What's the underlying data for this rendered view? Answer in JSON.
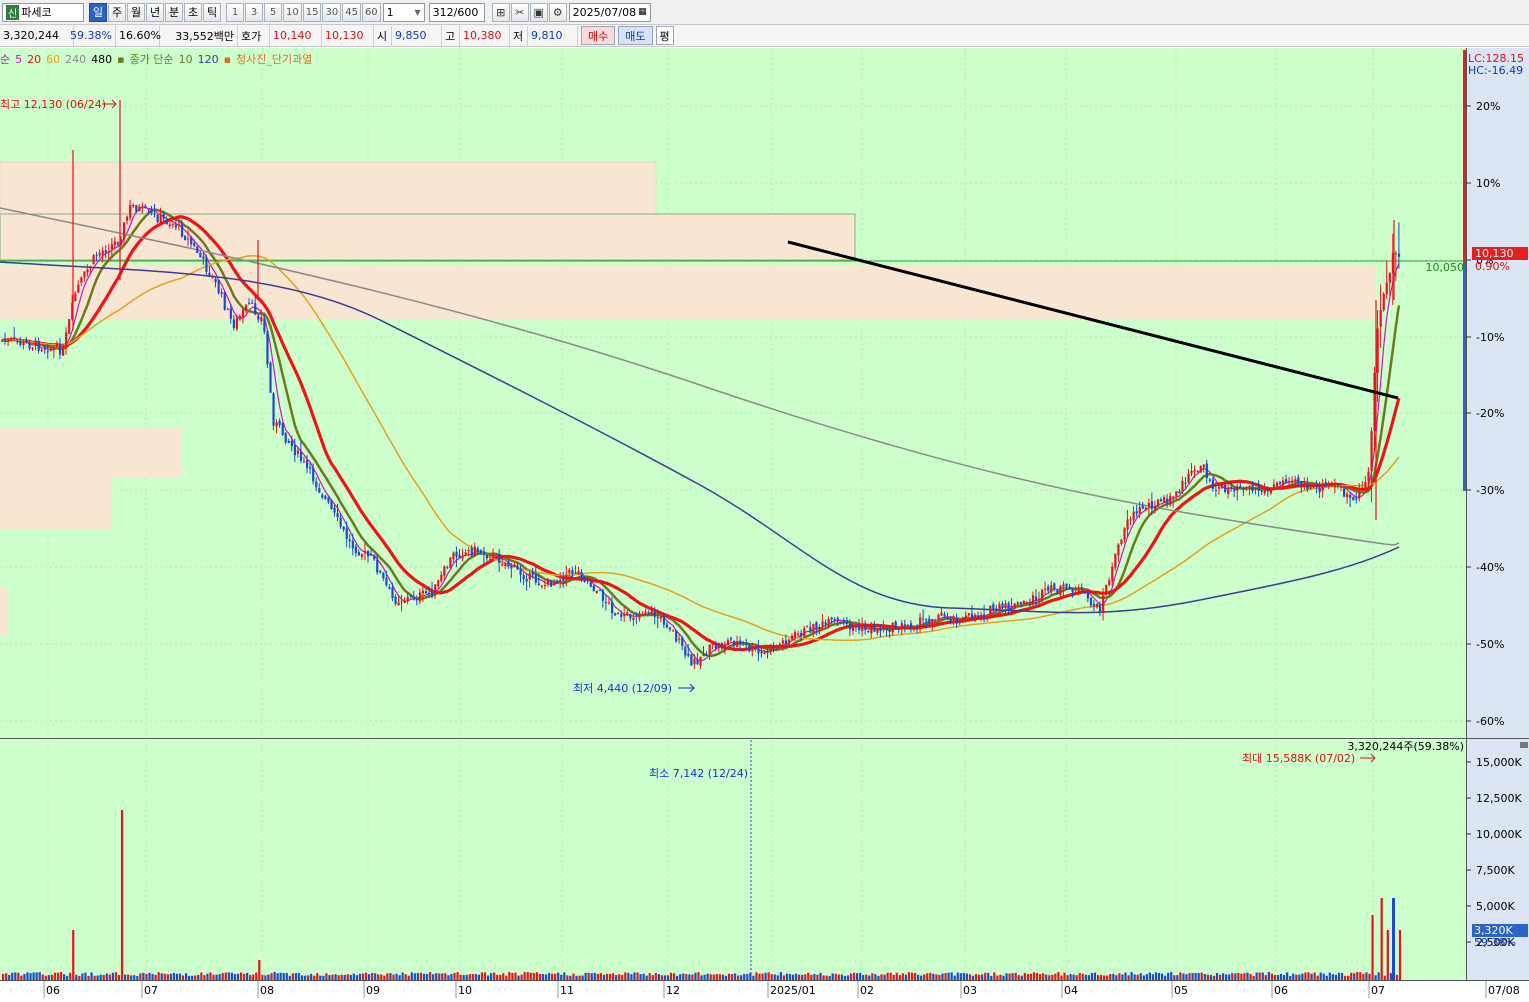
{
  "toolbar": {
    "badge": "신",
    "stock_name": "파세코",
    "periods": [
      "일",
      "주",
      "월",
      "년",
      "분",
      "초",
      "틱"
    ],
    "active_period": "일",
    "intervals": [
      "1",
      "3",
      "5",
      "10",
      "15",
      "30",
      "45",
      "60"
    ],
    "count_value": "1",
    "range_value": "312",
    "range_total": "/600",
    "date_value": "2025/07/08"
  },
  "quote": {
    "volume": "3,320,244",
    "volume_ratio": "59.38%",
    "turnover_rate": "16.60%",
    "amount": "33,552백만",
    "ask_label": "호가",
    "ask": "10,140",
    "bid": "10,130",
    "open_label": "시",
    "open": "9,850",
    "high_label": "고",
    "high": "10,380",
    "low_label": "저",
    "low": "9,810",
    "buy_label": "매수",
    "sell_label": "매도",
    "avg_label": "평"
  },
  "legend": {
    "ma_prefix": "순",
    "ma_items": [
      {
        "label": "5",
        "color": "#d012c8"
      },
      {
        "label": "20",
        "color": "#ef1414"
      },
      {
        "label": "60",
        "color": "#e3a21a"
      },
      {
        "label": "240",
        "color": "#8a8a8a"
      },
      {
        "label": "480",
        "color": "#000000"
      }
    ],
    "vol_prefix": "종가 단순",
    "vol_items": [
      {
        "label": "10",
        "color": "#6b7a1a"
      },
      {
        "label": "120",
        "color": "#3d3d8f"
      }
    ],
    "signal": "청사진_단기과열",
    "signal_color": "#e07020"
  },
  "price_panel": {
    "right_header_lc": "LC:128.15",
    "right_header_hc": "HC:-16.49",
    "pct_ticks": [
      "20%",
      "10%",
      "0%",
      "-10%",
      "-20%",
      "-30%",
      "-40%",
      "-50%",
      "-60%"
    ],
    "current_price": "10,130",
    "current_change": "0.90%",
    "ref_line_label": "10,050",
    "high_annotation": "최고 12,130 (06/24)",
    "low_annotation": "최저 4,440 (12/09)"
  },
  "volume_panel": {
    "top_label": "3,320,244주(59.38%)",
    "max_annotation": "최대 15,588K (07/02)",
    "min_annotation": "최소 7,142 (12/24)",
    "ticks": [
      "15,000K",
      "12,500K",
      "10,000K",
      "7,500K",
      "5,000K",
      "2,500K"
    ],
    "current_volume": "3,320K",
    "current_ratio": "59.38%"
  },
  "x_axis": [
    "06",
    "07",
    "08",
    "09",
    "10",
    "11",
    "12",
    "2025/01",
    "02",
    "03",
    "04",
    "05",
    "06",
    "07",
    "07/08"
  ],
  "colors": {
    "plot_bg": "#ccffcc",
    "axis_bg": "#dce5f3",
    "up": "#e8141c",
    "down": "#1a4ad0",
    "zone": "#f8e5d2",
    "trendline": "#000000"
  },
  "chart_data": {
    "type": "candlestick",
    "symbol": "파세코",
    "timeframe": "일",
    "date_range": [
      "2024/06",
      "2025/07/08"
    ],
    "last": {
      "open": 9850,
      "high": 10380,
      "low": 9810,
      "close": 10130,
      "volume": 3320244
    },
    "annotations": [
      {
        "label": "최고",
        "value": 12130,
        "date": "06/24"
      },
      {
        "label": "최저",
        "value": 4440,
        "date": "12/09"
      },
      {
        "label": "최대",
        "value": "15,588K",
        "date": "07/02"
      },
      {
        "label": "최소",
        "value": "7,142",
        "date": "12/24"
      }
    ],
    "y_axis_percent": [
      20,
      10,
      0,
      -10,
      -20,
      -30,
      -40,
      -50,
      -60
    ],
    "monthly_closes": [
      {
        "month": "2024/06",
        "price": 9600
      },
      {
        "month": "2024/07",
        "price": 10200
      },
      {
        "month": "2024/08",
        "price": 7300
      },
      {
        "month": "2024/09",
        "price": 5500
      },
      {
        "month": "2024/10",
        "price": 5550
      },
      {
        "month": "2024/11",
        "price": 5200
      },
      {
        "month": "2024/12",
        "price": 4900
      },
      {
        "month": "2025/01",
        "price": 4950
      },
      {
        "month": "2025/02",
        "price": 4950
      },
      {
        "month": "2025/03",
        "price": 5050
      },
      {
        "month": "2025/04",
        "price": 5500
      },
      {
        "month": "2025/05",
        "price": 6350
      },
      {
        "month": "2025/06",
        "price": 6200
      },
      {
        "month": "2025/07",
        "price": 10130
      }
    ]
  }
}
